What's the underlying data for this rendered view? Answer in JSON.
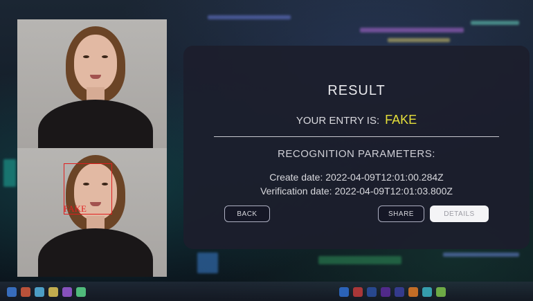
{
  "panel": {
    "title": "RESULT",
    "entry_label": "YOUR ENTRY IS:",
    "verdict": "FAKE",
    "params_heading": "RECOGNITION PARAMETERS:",
    "create_date": "Create date: 2022-04-09T12:01:00.284Z",
    "verification_date": "Verification date: 2022-04-09T12:01:03.800Z"
  },
  "buttons": {
    "back": "BACK",
    "share": "SHARE",
    "details": "DETAILS"
  },
  "detection": {
    "label": "FAKE"
  },
  "colors": {
    "verdict": "#e6e03a",
    "bbox": "#e11d1d",
    "panel_bg": "#1c1e2c"
  }
}
